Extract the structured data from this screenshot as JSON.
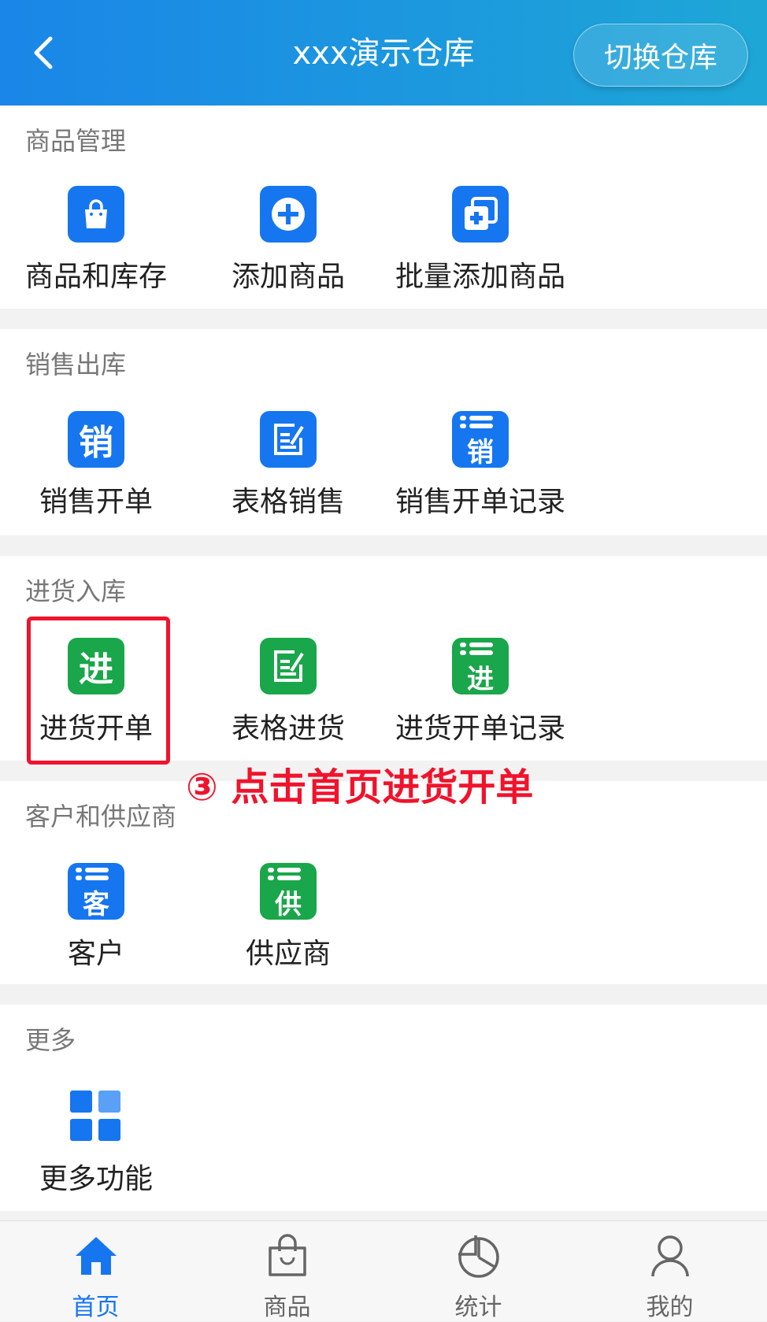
{
  "header": {
    "title": "xxx演示仓库",
    "switch_label": "切换仓库"
  },
  "sections": [
    {
      "title": "商品管理",
      "items": [
        {
          "label": "商品和库存",
          "icon": "shopping-bag-icon"
        },
        {
          "label": "添加商品",
          "icon": "plus-circle-icon"
        },
        {
          "label": "批量添加商品",
          "icon": "batch-add-icon"
        }
      ]
    },
    {
      "title": "销售出库",
      "items": [
        {
          "label": "销售开单",
          "icon": "sale-order-icon",
          "glyph": "销"
        },
        {
          "label": "表格销售",
          "icon": "edit-table-icon"
        },
        {
          "label": "销售开单记录",
          "icon": "sale-records-icon",
          "glyph": "销"
        }
      ]
    },
    {
      "title": "进货入库",
      "items": [
        {
          "label": "进货开单",
          "icon": "purchase-order-icon",
          "glyph": "进"
        },
        {
          "label": "表格进货",
          "icon": "edit-table-icon"
        },
        {
          "label": "进货开单记录",
          "icon": "purchase-records-icon",
          "glyph": "进"
        }
      ]
    },
    {
      "title": "客户和供应商",
      "items": [
        {
          "label": "客户",
          "icon": "customer-icon",
          "glyph": "客"
        },
        {
          "label": "供应商",
          "icon": "supplier-icon",
          "glyph": "供"
        }
      ]
    },
    {
      "title": "更多",
      "items": [
        {
          "label": "更多功能",
          "icon": "grid-icon"
        }
      ]
    }
  ],
  "annotation": "③ 点击首页进货开单",
  "tabs": [
    {
      "label": "首页",
      "icon": "home-icon",
      "active": true
    },
    {
      "label": "商品",
      "icon": "bag-icon"
    },
    {
      "label": "统计",
      "icon": "pie-chart-icon"
    },
    {
      "label": "我的",
      "icon": "user-icon"
    }
  ],
  "colors": {
    "header_start": "#1a86e8",
    "header_end": "#1ea7d6",
    "icon_blue": "#1676f0",
    "icon_green": "#1aa64a",
    "annotation_red": "#f0132c",
    "active_tab": "#1676f0"
  }
}
